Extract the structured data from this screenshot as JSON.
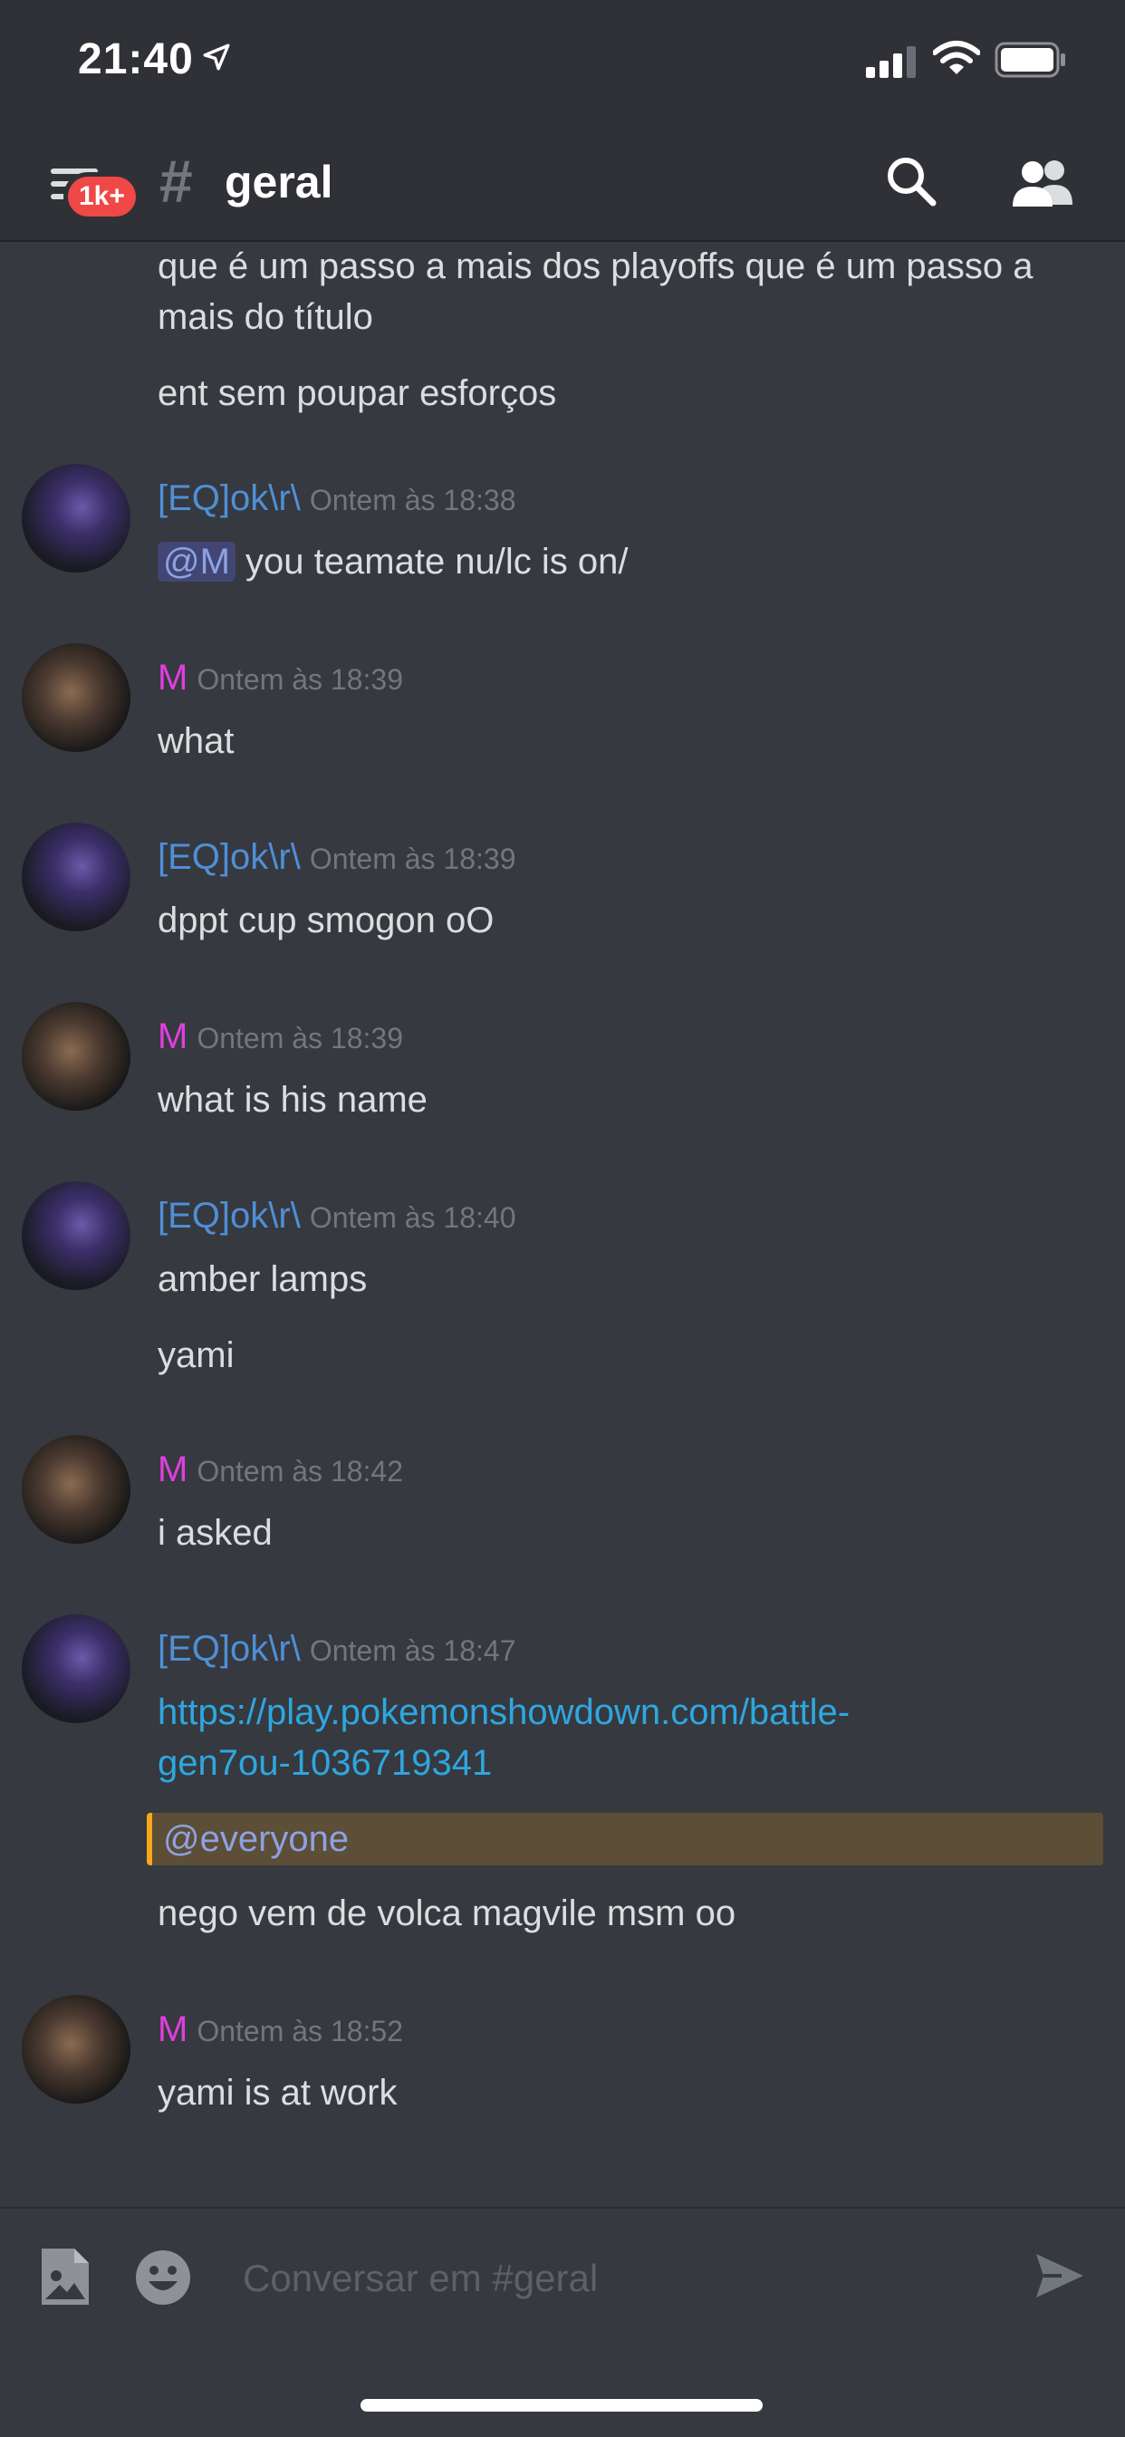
{
  "status_bar": {
    "time": "21:40"
  },
  "header": {
    "badge": "1k+",
    "hash": "#",
    "channel": "geral"
  },
  "messages": {
    "prev_line1": "que é um passo a mais dos playoffs que é um passo a",
    "prev_line2": "mais do título",
    "prev_line3": "ent sem poupar esforços",
    "m1": {
      "author": "[EQ]ok\\r\\",
      "time": "Ontem às 18:38",
      "mention": "@M",
      "text": " you teamate nu/lc is on/"
    },
    "m2": {
      "author": "M",
      "time": "Ontem às 18:39",
      "text": "what"
    },
    "m3": {
      "author": "[EQ]ok\\r\\",
      "time": "Ontem às 18:39",
      "text": "dppt cup smogon oO"
    },
    "m4": {
      "author": "M",
      "time": "Ontem às 18:39",
      "text": "what is his name"
    },
    "m5": {
      "author": "[EQ]ok\\r\\",
      "time": "Ontem às 18:40",
      "text1": "amber lamps",
      "text2": "yami"
    },
    "m6": {
      "author": "M",
      "time": "Ontem às 18:42",
      "text": "i asked"
    },
    "m7": {
      "author": "[EQ]ok\\r\\",
      "time": "Ontem às 18:47",
      "link_line1": "https://play.pokemonshowdown.com/battle-",
      "link_line2": "gen7ou-1036719341",
      "everyone": "@everyone",
      "text": "nego vem de volca magvile msm oo"
    },
    "m8": {
      "author": "M",
      "time": "Ontem às 18:52",
      "text": "yami is at work"
    }
  },
  "composer": {
    "placeholder": "Conversar em #geral"
  }
}
